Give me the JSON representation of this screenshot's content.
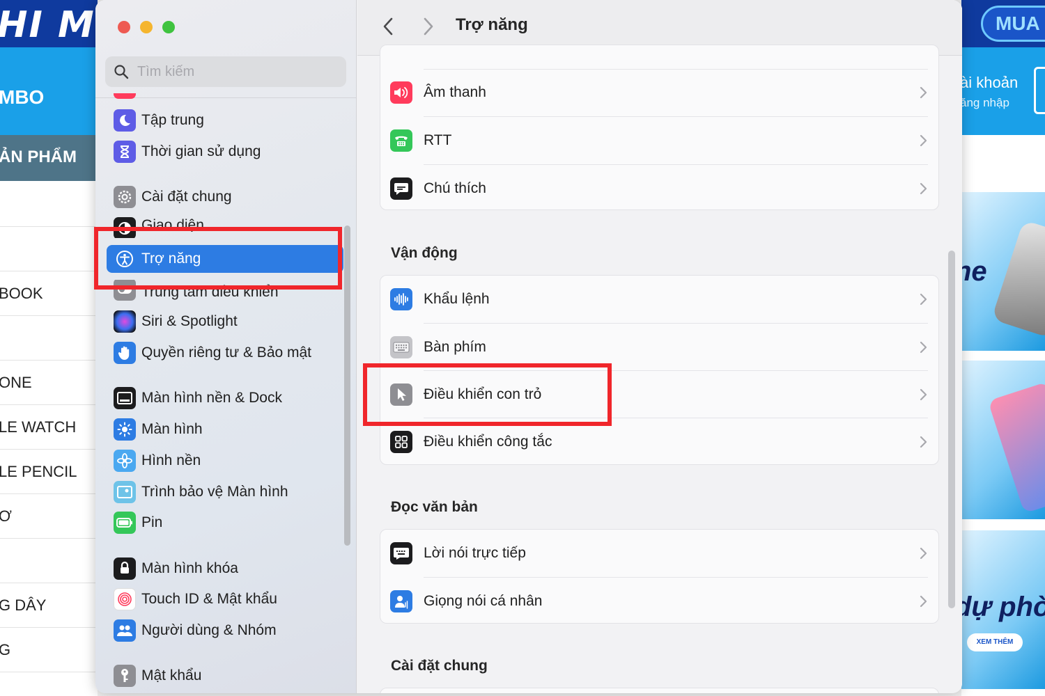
{
  "background_left": {
    "logo": "HI M",
    "combo": "MBO",
    "products": "ẢN PHẨM",
    "menu": [
      "",
      "",
      "BOOK",
      "",
      "ONE",
      "LE WATCH",
      "LE PENCIL",
      "Ơ",
      "",
      "G DÂY",
      "G"
    ]
  },
  "background_right": {
    "buy": "MUA",
    "account_line1": "ài khoản",
    "account_line2": "ăng nhập",
    "banner1_text": "ne",
    "banner2_text": "ı",
    "banner3_text": "dự phò",
    "see_more": "XEM THÊM"
  },
  "search": {
    "placeholder": "Tìm kiếm"
  },
  "sidebar": {
    "items": [
      {
        "label": "Tập trung",
        "icon": "moon-icon",
        "color": "#5e5ce6"
      },
      {
        "label": "Thời gian sử dụng",
        "icon": "hourglass-icon",
        "color": "#5e5ce6"
      },
      {
        "label": "Cài đặt chung",
        "icon": "gear-icon",
        "color": "#8e8e93"
      },
      {
        "label": "Giao diện",
        "icon": "appearance-icon",
        "color": "#1c1c1e"
      },
      {
        "label": "Trợ năng",
        "icon": "accessibility-icon",
        "color": "#2d7ce3"
      },
      {
        "label": "Trung tâm điều khiển",
        "icon": "toggle-icon",
        "color": "#8e8e93"
      },
      {
        "label": "Siri & Spotlight",
        "icon": "siri-icon",
        "color": "#1c1c1e"
      },
      {
        "label": "Quyền riêng tư & Bảo mật",
        "icon": "hand-icon",
        "color": "#2d7ce3"
      },
      {
        "label": "Màn hình nền & Dock",
        "icon": "dock-icon",
        "color": "#1c1c1e"
      },
      {
        "label": "Màn hình",
        "icon": "sun-icon",
        "color": "#2d7ce3"
      },
      {
        "label": "Hình nền",
        "icon": "flower-icon",
        "color": "#4aa8f0"
      },
      {
        "label": "Trình bảo vệ Màn hình",
        "icon": "screensaver-icon",
        "color": "#6ec3e8"
      },
      {
        "label": "Pin",
        "icon": "battery-icon",
        "color": "#34c759"
      },
      {
        "label": "Màn hình khóa",
        "icon": "lock-icon",
        "color": "#1c1c1e"
      },
      {
        "label": "Touch ID & Mật khẩu",
        "icon": "fingerprint-icon",
        "color": "#ffffff"
      },
      {
        "label": "Người dùng & Nhóm",
        "icon": "users-icon",
        "color": "#2d7ce3"
      },
      {
        "label": "Mật khẩu",
        "icon": "key-icon",
        "color": "#8e8e93"
      }
    ]
  },
  "main": {
    "title": "Trợ năng",
    "hearing_rows": [
      {
        "label": "Âm thanh",
        "icon": "speaker-icon",
        "color": "#ff3b5c"
      },
      {
        "label": "RTT",
        "icon": "rtt-icon",
        "color": "#34c759"
      },
      {
        "label": "Chú thích",
        "icon": "caption-icon",
        "color": "#1c1c1e"
      }
    ],
    "motor_title": "Vận động",
    "motor_rows": [
      {
        "label": "Khẩu lệnh",
        "icon": "waveform-icon",
        "color": "#2d7ce3"
      },
      {
        "label": "Bàn phím",
        "icon": "keyboard-icon",
        "color": "#a5a5aa"
      },
      {
        "label": "Điều khiển con trỏ",
        "icon": "pointer-icon",
        "color": "#8e8e93"
      },
      {
        "label": "Điều khiển công tắc",
        "icon": "grid-icon",
        "color": "#1c1c1e"
      }
    ],
    "speech_title": "Đọc văn bản",
    "speech_rows": [
      {
        "label": "Lời nói trực tiếp",
        "icon": "live-speech-icon",
        "color": "#1c1c1e"
      },
      {
        "label": "Giọng nói cá nhân",
        "icon": "personal-voice-icon",
        "color": "#2d7ce3"
      }
    ],
    "general_title": "Cài đặt chung"
  },
  "highlight_color": "#f0262b"
}
